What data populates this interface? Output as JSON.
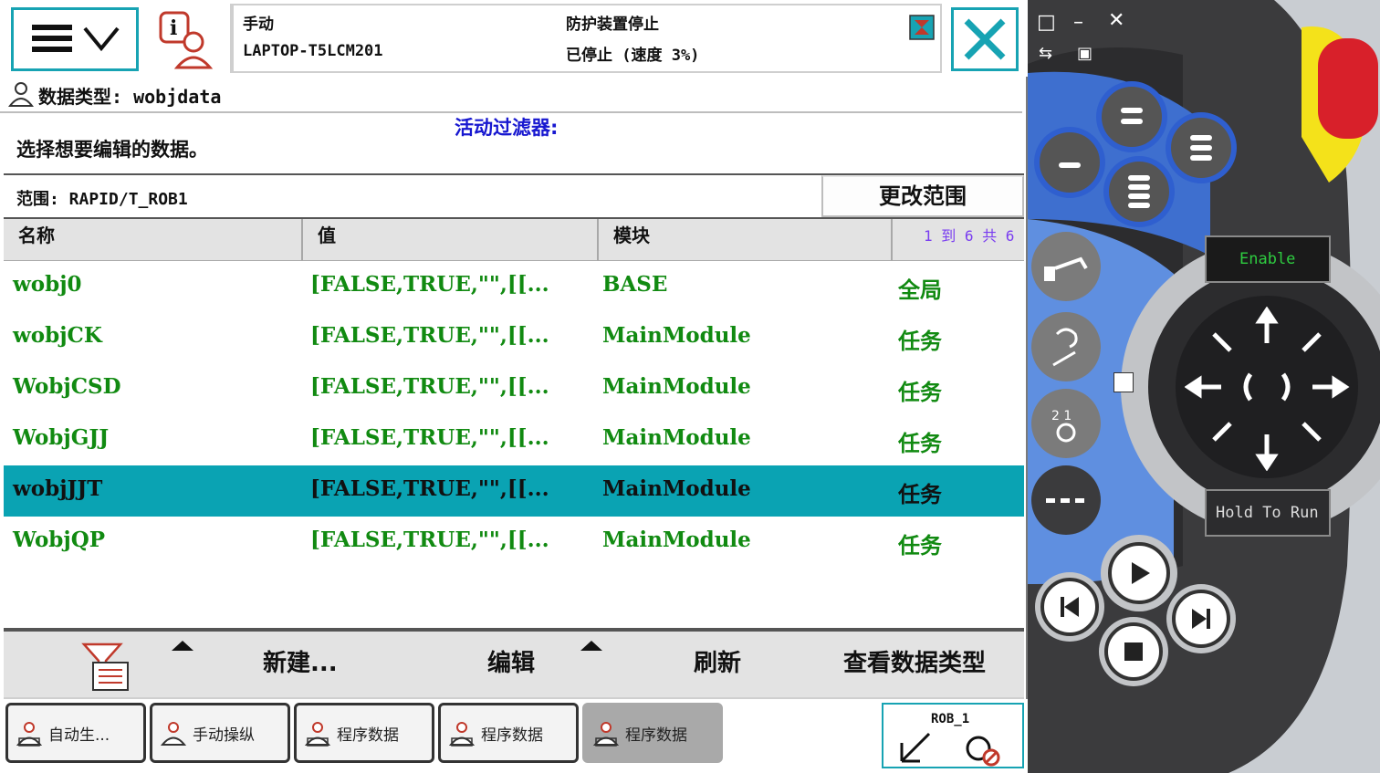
{
  "status": {
    "mode": "手动",
    "controller": "LAPTOP-T5LCM201",
    "state": "防护装置停止",
    "speed": "已停止 (速度 3%)"
  },
  "title": {
    "label": "数据类型: wobjdata"
  },
  "instruction": "选择想要编辑的数据。",
  "filter": "活动过滤器:",
  "scope": {
    "text": "范围: RAPID/T_ROB1",
    "button": "更改范围"
  },
  "table": {
    "headers": [
      "名称",
      "值",
      "模块"
    ],
    "page_info": "1 到 6 共 6",
    "rows": [
      {
        "name": "wobj0",
        "value": "[FALSE,TRUE,\"\",[[...",
        "module": "BASE",
        "scope": "全局"
      },
      {
        "name": "wobjCK",
        "value": "[FALSE,TRUE,\"\",[[...",
        "module": "MainModule",
        "scope": "任务"
      },
      {
        "name": "WobjCSD",
        "value": "[FALSE,TRUE,\"\",[[...",
        "module": "MainModule",
        "scope": "任务"
      },
      {
        "name": "WobjGJJ",
        "value": "[FALSE,TRUE,\"\",[[...",
        "module": "MainModule",
        "scope": "任务"
      },
      {
        "name": "wobjJJT",
        "value": "[FALSE,TRUE,\"\",[[...",
        "module": "MainModule",
        "scope": "任务",
        "selected": true
      },
      {
        "name": "WobjQP",
        "value": "[FALSE,TRUE,\"\",[[...",
        "module": "MainModule",
        "scope": "任务"
      }
    ]
  },
  "toolbar": {
    "new": "新建...",
    "edit": "编辑",
    "refresh": "刷新",
    "view_type": "查看数据类型"
  },
  "taskbar": {
    "tasks": [
      "自动生...",
      "手动操纵",
      "程序数据",
      "程序数据",
      "程序数据"
    ],
    "robot": "ROB_1"
  },
  "hardware": {
    "enable": "Enable",
    "hold_to_run": "Hold To Run"
  },
  "colors": {
    "accent": "#0aa3b3",
    "value_text": "#118a11",
    "filter_text": "#1818d0"
  }
}
